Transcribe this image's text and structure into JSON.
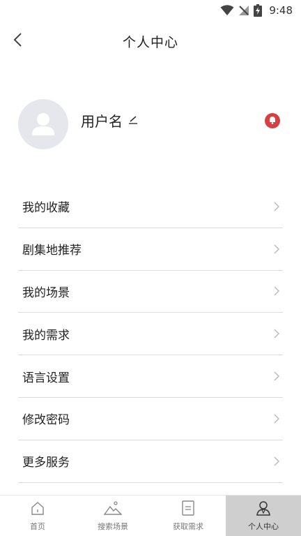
{
  "status_bar": {
    "time": "9:48",
    "icons": [
      "wifi-icon",
      "no-signal-icon",
      "battery-charging-icon"
    ]
  },
  "header": {
    "title": "个人中心",
    "back_icon": "chevron-left-icon"
  },
  "profile": {
    "username": "用户名",
    "edit_icon": "pencil-icon",
    "avatar_icon": "user-placeholder-icon",
    "notification_icon": "bell-icon",
    "notification_color": "#d64040"
  },
  "menu": {
    "items": [
      {
        "label": "我的收藏"
      },
      {
        "label": "剧集地推荐"
      },
      {
        "label": "我的场景"
      },
      {
        "label": "我的需求"
      },
      {
        "label": "语言设置"
      },
      {
        "label": "修改密码"
      },
      {
        "label": "更多服务"
      }
    ],
    "chevron_icon": "chevron-right-icon"
  },
  "bottom_nav": {
    "items": [
      {
        "label": "首页",
        "icon": "home-icon"
      },
      {
        "label": "搜索场景",
        "icon": "mountain-icon"
      },
      {
        "label": "获取需求",
        "icon": "document-icon"
      },
      {
        "label": "个人中心",
        "icon": "person-icon"
      }
    ],
    "active_index": 3,
    "active_bg": "#cfcfcf"
  }
}
